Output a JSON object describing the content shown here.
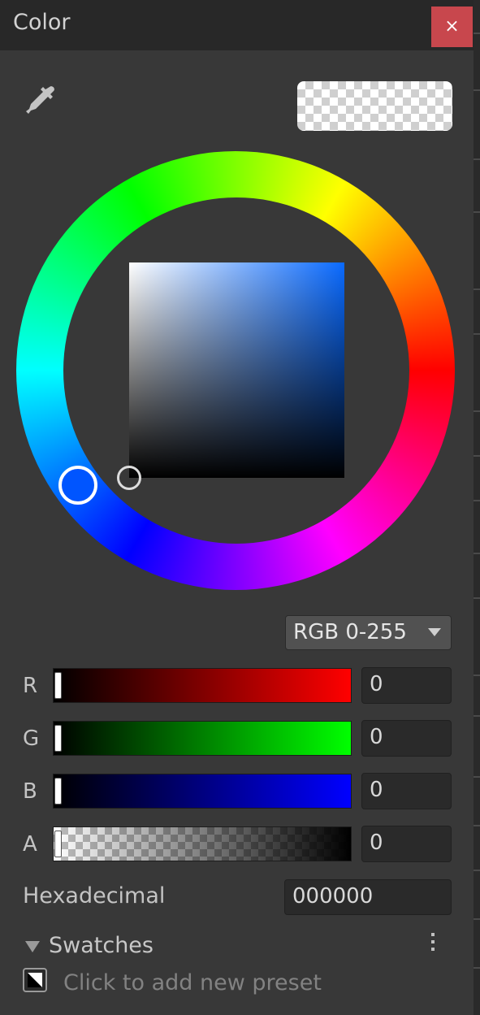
{
  "window": {
    "title": "Color",
    "close_glyph": "×"
  },
  "icons": {
    "eyedropper": "eyedropper-icon",
    "close": "close-icon",
    "dropdown": "chevron-down-icon",
    "more": "kebab-menu-icon"
  },
  "preview": {
    "color": "#000000",
    "alpha": 0
  },
  "picker": {
    "hue_color": "#0055ff"
  },
  "mode_select": {
    "value": "RGB 0-255"
  },
  "channels": [
    {
      "label": "R",
      "value": "0"
    },
    {
      "label": "G",
      "value": "0"
    },
    {
      "label": "B",
      "value": "0"
    },
    {
      "label": "A",
      "value": "0"
    }
  ],
  "hex": {
    "label": "Hexadecimal",
    "value": "000000"
  },
  "swatches": {
    "label": "Swatches",
    "add_preset": "Click to add new preset"
  },
  "colors": {
    "background": "#383838",
    "titlebar": "#282828",
    "close": "#c8474d"
  }
}
